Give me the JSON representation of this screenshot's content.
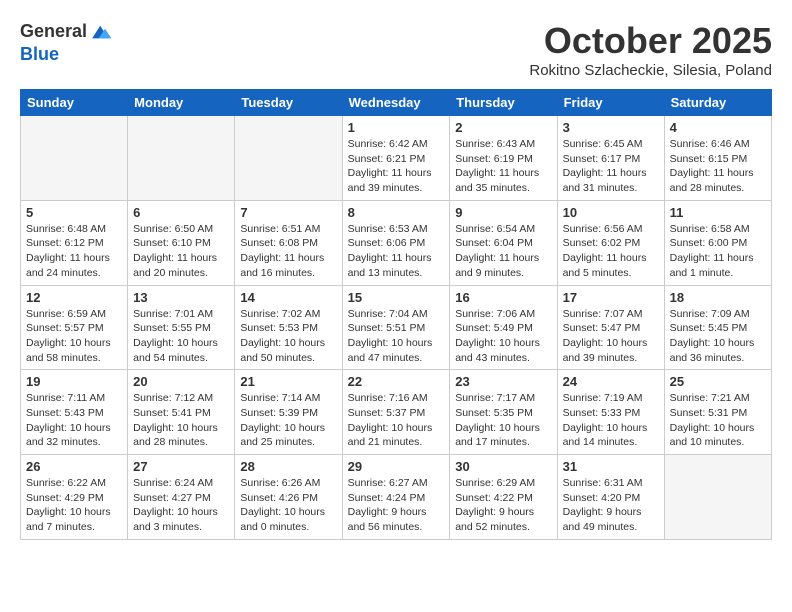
{
  "header": {
    "logo_line1": "General",
    "logo_line2": "Blue",
    "month": "October 2025",
    "location": "Rokitno Szlacheckie, Silesia, Poland"
  },
  "weekdays": [
    "Sunday",
    "Monday",
    "Tuesday",
    "Wednesday",
    "Thursday",
    "Friday",
    "Saturday"
  ],
  "weeks": [
    [
      {
        "day": "",
        "info": ""
      },
      {
        "day": "",
        "info": ""
      },
      {
        "day": "",
        "info": ""
      },
      {
        "day": "1",
        "info": "Sunrise: 6:42 AM\nSunset: 6:21 PM\nDaylight: 11 hours\nand 39 minutes."
      },
      {
        "day": "2",
        "info": "Sunrise: 6:43 AM\nSunset: 6:19 PM\nDaylight: 11 hours\nand 35 minutes."
      },
      {
        "day": "3",
        "info": "Sunrise: 6:45 AM\nSunset: 6:17 PM\nDaylight: 11 hours\nand 31 minutes."
      },
      {
        "day": "4",
        "info": "Sunrise: 6:46 AM\nSunset: 6:15 PM\nDaylight: 11 hours\nand 28 minutes."
      }
    ],
    [
      {
        "day": "5",
        "info": "Sunrise: 6:48 AM\nSunset: 6:12 PM\nDaylight: 11 hours\nand 24 minutes."
      },
      {
        "day": "6",
        "info": "Sunrise: 6:50 AM\nSunset: 6:10 PM\nDaylight: 11 hours\nand 20 minutes."
      },
      {
        "day": "7",
        "info": "Sunrise: 6:51 AM\nSunset: 6:08 PM\nDaylight: 11 hours\nand 16 minutes."
      },
      {
        "day": "8",
        "info": "Sunrise: 6:53 AM\nSunset: 6:06 PM\nDaylight: 11 hours\nand 13 minutes."
      },
      {
        "day": "9",
        "info": "Sunrise: 6:54 AM\nSunset: 6:04 PM\nDaylight: 11 hours\nand 9 minutes."
      },
      {
        "day": "10",
        "info": "Sunrise: 6:56 AM\nSunset: 6:02 PM\nDaylight: 11 hours\nand 5 minutes."
      },
      {
        "day": "11",
        "info": "Sunrise: 6:58 AM\nSunset: 6:00 PM\nDaylight: 11 hours\nand 1 minute."
      }
    ],
    [
      {
        "day": "12",
        "info": "Sunrise: 6:59 AM\nSunset: 5:57 PM\nDaylight: 10 hours\nand 58 minutes."
      },
      {
        "day": "13",
        "info": "Sunrise: 7:01 AM\nSunset: 5:55 PM\nDaylight: 10 hours\nand 54 minutes."
      },
      {
        "day": "14",
        "info": "Sunrise: 7:02 AM\nSunset: 5:53 PM\nDaylight: 10 hours\nand 50 minutes."
      },
      {
        "day": "15",
        "info": "Sunrise: 7:04 AM\nSunset: 5:51 PM\nDaylight: 10 hours\nand 47 minutes."
      },
      {
        "day": "16",
        "info": "Sunrise: 7:06 AM\nSunset: 5:49 PM\nDaylight: 10 hours\nand 43 minutes."
      },
      {
        "day": "17",
        "info": "Sunrise: 7:07 AM\nSunset: 5:47 PM\nDaylight: 10 hours\nand 39 minutes."
      },
      {
        "day": "18",
        "info": "Sunrise: 7:09 AM\nSunset: 5:45 PM\nDaylight: 10 hours\nand 36 minutes."
      }
    ],
    [
      {
        "day": "19",
        "info": "Sunrise: 7:11 AM\nSunset: 5:43 PM\nDaylight: 10 hours\nand 32 minutes."
      },
      {
        "day": "20",
        "info": "Sunrise: 7:12 AM\nSunset: 5:41 PM\nDaylight: 10 hours\nand 28 minutes."
      },
      {
        "day": "21",
        "info": "Sunrise: 7:14 AM\nSunset: 5:39 PM\nDaylight: 10 hours\nand 25 minutes."
      },
      {
        "day": "22",
        "info": "Sunrise: 7:16 AM\nSunset: 5:37 PM\nDaylight: 10 hours\nand 21 minutes."
      },
      {
        "day": "23",
        "info": "Sunrise: 7:17 AM\nSunset: 5:35 PM\nDaylight: 10 hours\nand 17 minutes."
      },
      {
        "day": "24",
        "info": "Sunrise: 7:19 AM\nSunset: 5:33 PM\nDaylight: 10 hours\nand 14 minutes."
      },
      {
        "day": "25",
        "info": "Sunrise: 7:21 AM\nSunset: 5:31 PM\nDaylight: 10 hours\nand 10 minutes."
      }
    ],
    [
      {
        "day": "26",
        "info": "Sunrise: 6:22 AM\nSunset: 4:29 PM\nDaylight: 10 hours\nand 7 minutes."
      },
      {
        "day": "27",
        "info": "Sunrise: 6:24 AM\nSunset: 4:27 PM\nDaylight: 10 hours\nand 3 minutes."
      },
      {
        "day": "28",
        "info": "Sunrise: 6:26 AM\nSunset: 4:26 PM\nDaylight: 10 hours\nand 0 minutes."
      },
      {
        "day": "29",
        "info": "Sunrise: 6:27 AM\nSunset: 4:24 PM\nDaylight: 9 hours\nand 56 minutes."
      },
      {
        "day": "30",
        "info": "Sunrise: 6:29 AM\nSunset: 4:22 PM\nDaylight: 9 hours\nand 52 minutes."
      },
      {
        "day": "31",
        "info": "Sunrise: 6:31 AM\nSunset: 4:20 PM\nDaylight: 9 hours\nand 49 minutes."
      },
      {
        "day": "",
        "info": ""
      }
    ]
  ]
}
